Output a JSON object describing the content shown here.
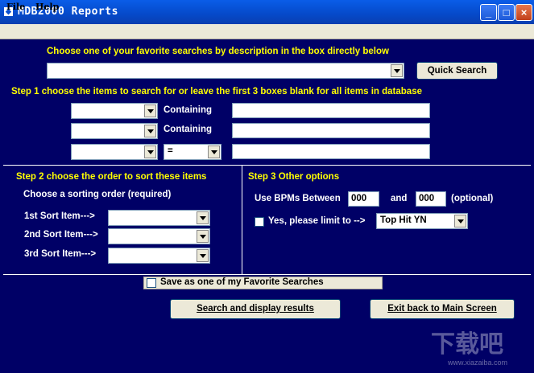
{
  "window": {
    "title": "MDB2000 Reports",
    "minimize": "_",
    "maximize": "□",
    "close": "×"
  },
  "menu": {
    "file": "File",
    "help": "Help"
  },
  "favorites": {
    "label": "Choose one of your favorite searches by description in the box directly below",
    "quick_search": "Quick Search"
  },
  "step1": {
    "label": "Step 1 choose the items to search for or leave the first 3 boxes blank for all items in database",
    "rows": [
      {
        "operator": "Containing"
      },
      {
        "operator": "Containing"
      },
      {
        "operator": "="
      }
    ]
  },
  "step2": {
    "label": "Step 2 choose the order to sort these items",
    "sublabel": "Choose a sorting order (required)",
    "sort_items": [
      "1st Sort Item--->",
      "2nd Sort Item--->",
      "3rd Sort Item--->"
    ]
  },
  "step3": {
    "label": "Step 3 Other options",
    "bpm_label": "Use BPMs Between",
    "bpm_from": "000",
    "and_label": "and",
    "bpm_to": "000",
    "optional": "(optional)",
    "limit_label": "Yes, please limit to -->",
    "limit_value": "Top Hit YN"
  },
  "save_favorite": "Save as one of my Favorite Searches",
  "buttons": {
    "search": "Search and display results",
    "exit": "Exit back to Main Screen"
  },
  "watermark": {
    "text": "下载吧",
    "url": "www.xiazaiba.com"
  }
}
